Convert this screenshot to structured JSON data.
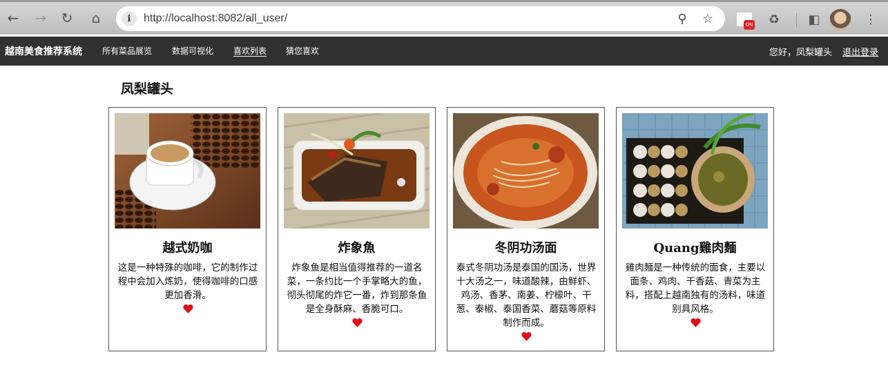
{
  "browser": {
    "url": "http://localhost:8082/all_user/"
  },
  "navbar": {
    "brand": "越南美食推荐系统",
    "links": [
      {
        "label": "所有菜品展览",
        "active": false
      },
      {
        "label": "数据可视化",
        "active": false
      },
      {
        "label": "喜欢列表",
        "active": true
      },
      {
        "label": "猜您喜欢",
        "active": false
      }
    ],
    "greeting": "您好，凤梨罐头",
    "logout": "退出登录"
  },
  "main": {
    "title": "凤梨罐头",
    "cards": [
      {
        "name": "越式奶咖",
        "desc": "这是一种特殊的咖啡，它的制作过程中会加入炼奶，使得咖啡的口感更加香滑。",
        "photo": "coffee-cup-photo"
      },
      {
        "name": "炸象魚",
        "desc": "炸象鱼是相当值得推荐的一道名菜，一条约比一个手掌略大的鱼，彻头彻尾的炸它一番，炸到那条鱼是全身酥麻、香脆可口。",
        "photo": "fried-fish-photo"
      },
      {
        "name": "冬阴功汤面",
        "desc": "泰式冬阴功汤是泰国的国汤，世界十大汤之一，味道酸辣，由鲜虾、鸡汤、香茅、南姜、柠檬叶、干葱、泰椒、泰国香菜、蘑菇等原料制作而成。",
        "photo": "tom-yum-noodle-photo"
      },
      {
        "name": "Quang雞肉麵",
        "desc": "雞肉麵是一种传统的面食，主要以面条、鸡肉、干香菇、青菜为主料，搭配上越南独有的汤料，味道别具风格。",
        "photo": "chicken-noodle-photo"
      }
    ]
  },
  "colors": {
    "navbar_bg": "#313131",
    "heart": "#e0101a"
  },
  "icons": [
    "back-arrow-icon",
    "forward-arrow-icon",
    "reload-icon",
    "home-icon",
    "info-icon",
    "zoom-icon",
    "star-icon",
    "extension-icon",
    "puzzle-icon",
    "sidebar-icon",
    "avatar",
    "menu-icon",
    "heart-icon"
  ]
}
